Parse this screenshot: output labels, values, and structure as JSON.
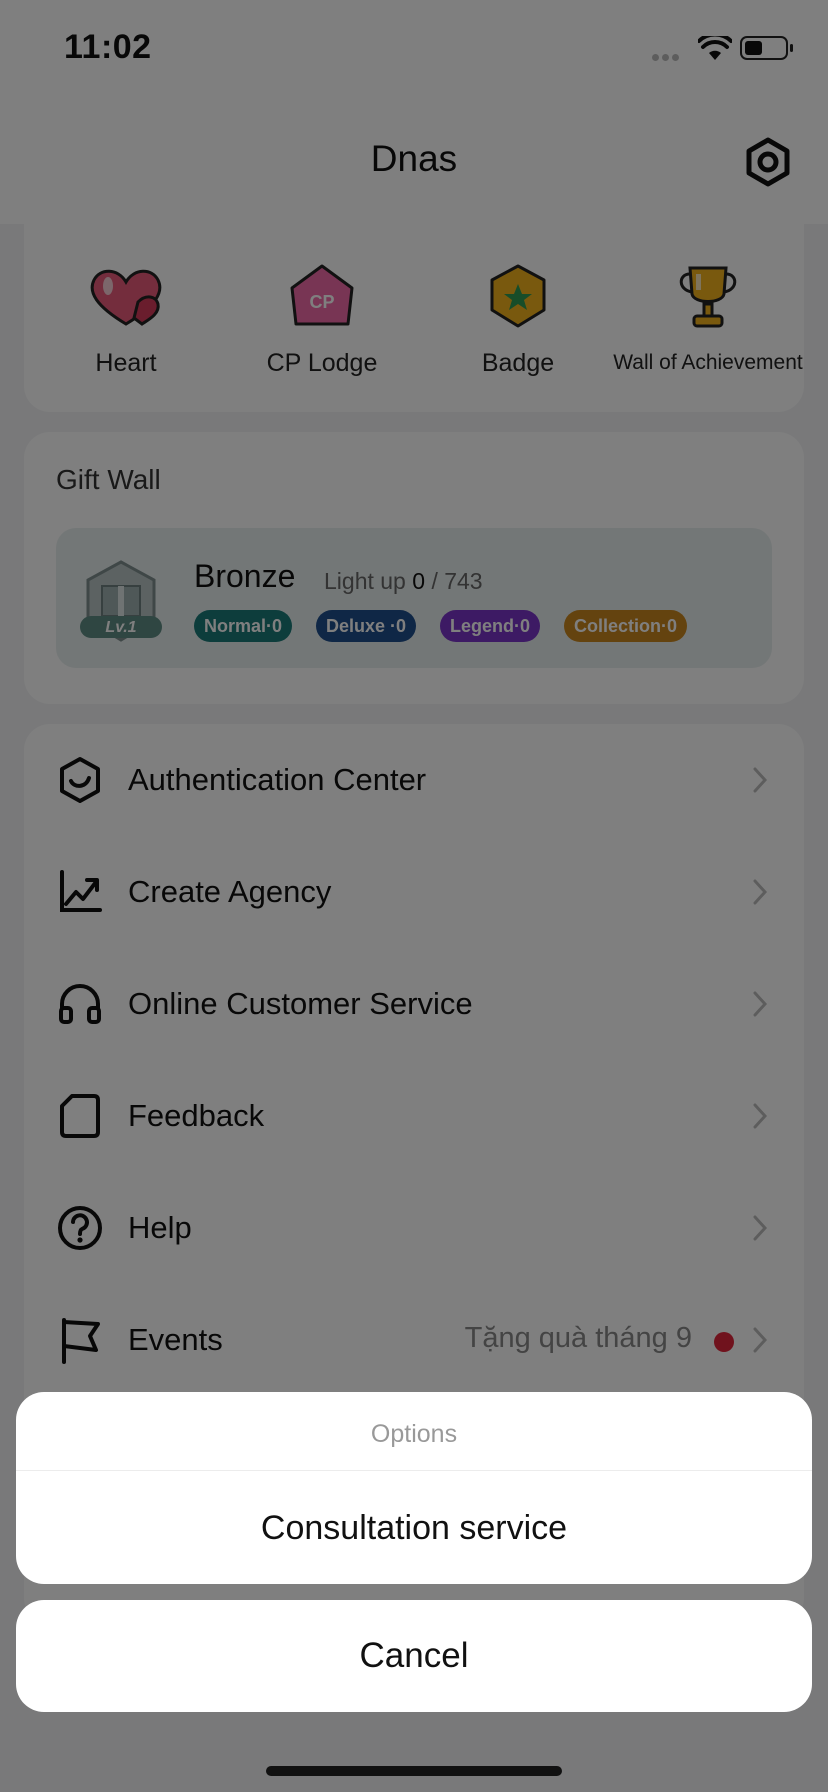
{
  "status_bar": {
    "time": "11:02"
  },
  "navbar": {
    "title": "Dnas"
  },
  "achievements": [
    {
      "label": "Heart",
      "icon": "heart-icon"
    },
    {
      "label": "CP Lodge",
      "icon": "cp-lodge-icon",
      "icon_text": "CP"
    },
    {
      "label": "Badge",
      "icon": "badge-icon"
    },
    {
      "label": "Wall of Achievement",
      "icon": "trophy-icon"
    }
  ],
  "gift_wall": {
    "title": "Gift Wall",
    "level_badge": "Lv.1",
    "tier": "Bronze",
    "light_up_label": "Light up",
    "lit": "0",
    "total": "/ 743",
    "pills": [
      {
        "label": "Normal·0",
        "color": "#1a7a78"
      },
      {
        "label": "Deluxe ·0",
        "color": "#1f4f8c"
      },
      {
        "label": "Legend·0",
        "color": "#7b35c9"
      },
      {
        "label": "Collection·0",
        "color": "#c9861f"
      }
    ]
  },
  "menu": [
    {
      "label": "Authentication Center",
      "icon": "shield-check-icon"
    },
    {
      "label": "Create Agency",
      "icon": "trend-chart-icon"
    },
    {
      "label": "Online Customer Service",
      "icon": "headset-icon"
    },
    {
      "label": "Feedback",
      "icon": "document-icon"
    },
    {
      "label": "Help",
      "icon": "question-circle-icon"
    },
    {
      "label": "Events",
      "icon": "flag-icon",
      "extra": "Tặng quà tháng 9"
    }
  ],
  "action_sheet": {
    "title": "Options",
    "items": [
      "Consultation service"
    ],
    "cancel": "Cancel"
  },
  "colors": {
    "overlay": "rgba(0,0,0,0.5)",
    "event_dot": "#e0253a"
  }
}
